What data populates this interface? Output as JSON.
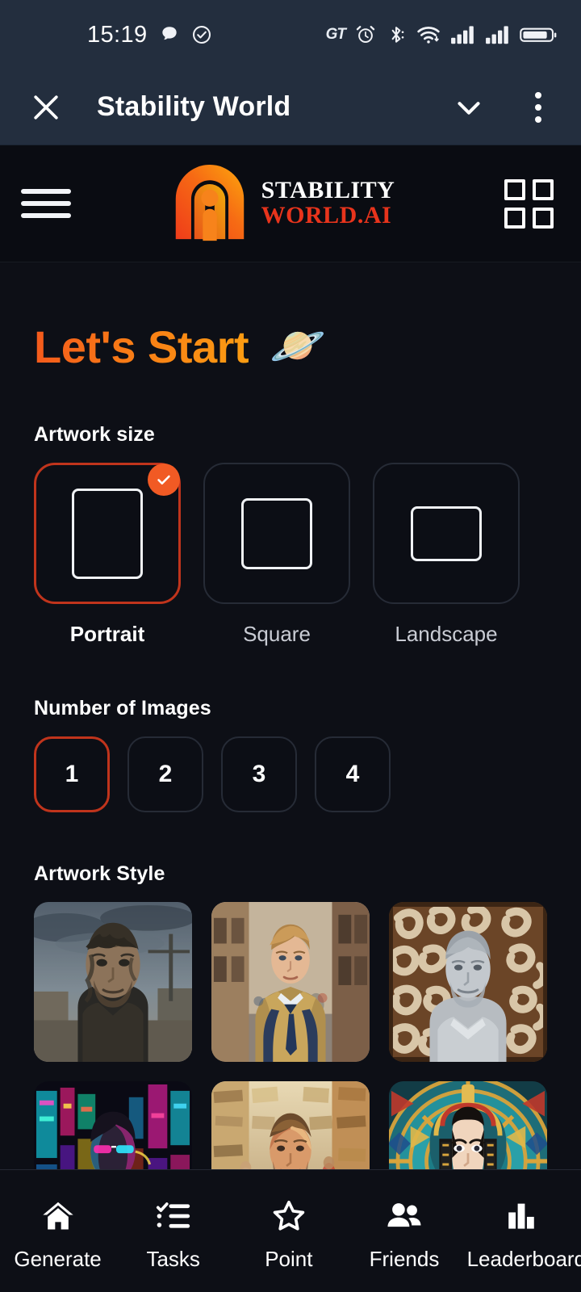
{
  "status_bar": {
    "time": "15:19",
    "gt_label": "GT",
    "icons": [
      "chat-bubble-icon",
      "check-circle-icon",
      "gt-label",
      "alarm-icon",
      "bluetooth-icon",
      "wifi-icon",
      "signal-icon-1",
      "signal-icon-2",
      "battery-icon"
    ]
  },
  "title_bar": {
    "close_icon": "close-icon",
    "title": "Stability World",
    "chevron_icon": "chevron-down-icon",
    "more_icon": "more-vertical-icon"
  },
  "app_header": {
    "menu_icon": "hamburger-menu-icon",
    "logo_icon": "stability-world-logo-icon",
    "brand_line1": "STABILITY",
    "brand_line2": "WORLD.AI",
    "grid_icon": "grid-view-icon"
  },
  "main": {
    "heading": "Let's Start",
    "heading_emoji": "🪐",
    "artwork_size": {
      "label": "Artwork size",
      "options": [
        {
          "label": "Portrait",
          "shape": "portrait",
          "selected": true
        },
        {
          "label": "Square",
          "shape": "square",
          "selected": false
        },
        {
          "label": "Landscape",
          "shape": "landscape",
          "selected": false
        }
      ]
    },
    "number_of_images": {
      "label": "Number of Images",
      "options": [
        "1",
        "2",
        "3",
        "4"
      ],
      "selected": "1"
    },
    "artwork_style": {
      "label": "Artwork Style",
      "tiles": [
        {
          "name": "post-apocalyptic-portrait"
        },
        {
          "name": "street-fashion-portrait"
        },
        {
          "name": "carved-relief-portrait"
        },
        {
          "name": "cyberpunk-neon-portrait"
        },
        {
          "name": "impressionist-painting-portrait"
        },
        {
          "name": "art-deco-stained-glass-portrait"
        }
      ]
    }
  },
  "bottom_nav": {
    "items": [
      {
        "label": "Generate",
        "icon": "home-icon",
        "active": true
      },
      {
        "label": "Tasks",
        "icon": "checklist-icon",
        "active": false
      },
      {
        "label": "Point",
        "icon": "star-icon",
        "active": false
      },
      {
        "label": "Friends",
        "icon": "people-icon",
        "active": false
      },
      {
        "label": "Leaderboard",
        "icon": "bar-chart-icon",
        "active": false
      }
    ]
  },
  "colors": {
    "background": "#0d0f16",
    "status_bar": "#232e3e",
    "accent_orange": "#f15a24",
    "accent_red": "#c0341c",
    "brand_red": "#e8341c",
    "text_primary": "#ffffff",
    "text_muted": "#c9ccd4",
    "card_border": "#262b36"
  }
}
